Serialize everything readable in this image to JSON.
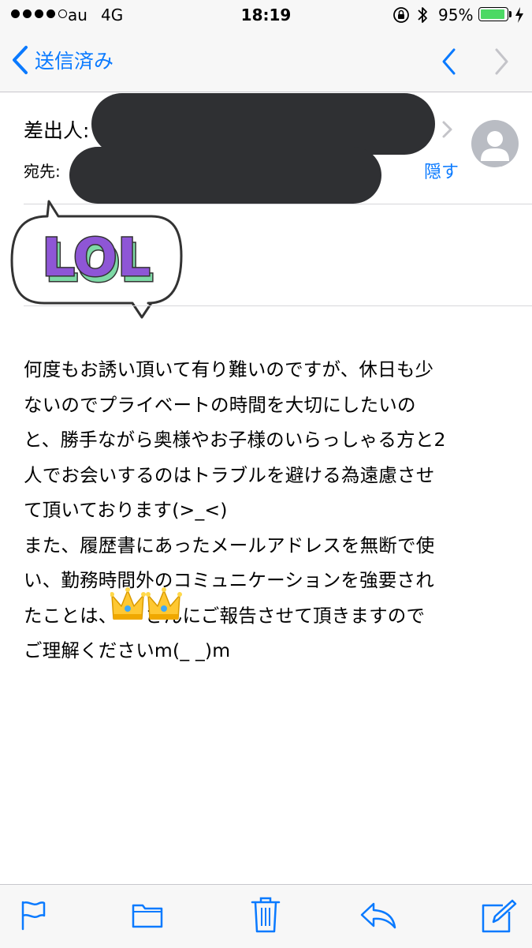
{
  "status_bar": {
    "carrier": "au",
    "network": "4G",
    "time": "18:19",
    "battery_percent": "95%",
    "battery_level": 0.95
  },
  "nav": {
    "back_label": "送信済み"
  },
  "header": {
    "from_label": "差出人:",
    "to_label": "宛先:",
    "hide_label": "隠す"
  },
  "sticker": {
    "text": "LOL"
  },
  "body": {
    "lines": [
      "何度もお誘い頂いて有り難いのですが、休日も少",
      "ないのでプライベートの時間を大切にしたいの",
      "と、勝手ながら奥様やお子様のいらっしゃる方と2",
      "人でお会いするのはトラブルを避ける為遠慮させ",
      "て頂いております(>_<)",
      "また、履歴書にあったメールアドレスを無断で使",
      "い、勤務時間外のコミュニケーションを強要され",
      "たことは、　　さんにご報告させて頂きますので",
      "ご理解くださいm(_ _)m"
    ]
  },
  "toolbar": {
    "items": [
      "flag-icon",
      "folder-icon",
      "trash-icon",
      "reply-icon",
      "compose-icon"
    ]
  },
  "colors": {
    "accent": "#0a7aff",
    "redaction": "#2f3033",
    "sticker_purple": "#8e56d6",
    "sticker_green": "#7ed9a6"
  }
}
